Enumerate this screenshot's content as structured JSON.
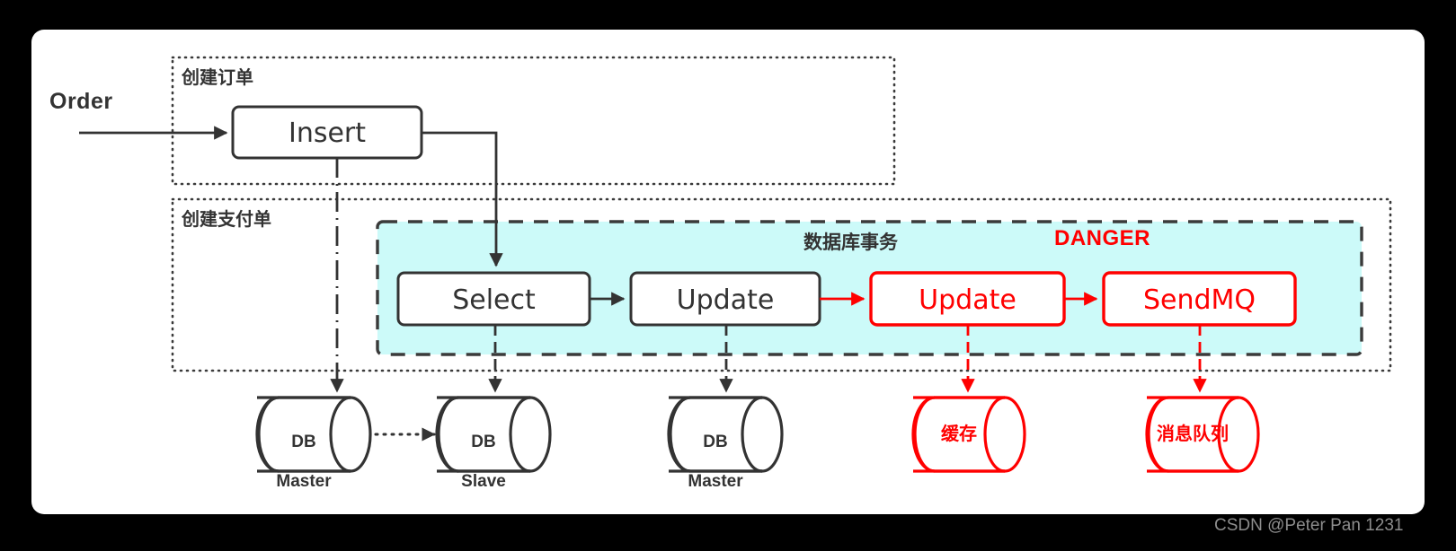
{
  "colors": {
    "canvas_background": "#000000",
    "card_background": "#ffffff",
    "ink": "#333333",
    "danger_red": "#FF0000",
    "transaction_fill": "#CCFAF9"
  },
  "entry": {
    "label": "Order"
  },
  "groups": [
    {
      "id": "create-order",
      "label": "创建订单"
    },
    {
      "id": "create-payment",
      "label": "创建支付单"
    }
  ],
  "transaction": {
    "label": "数据库事务",
    "danger_label": "DANGER"
  },
  "nodes": [
    {
      "id": "insert",
      "label": "Insert",
      "color": "ink"
    },
    {
      "id": "select",
      "label": "Select",
      "color": "ink"
    },
    {
      "id": "update-1",
      "label": "Update",
      "color": "ink"
    },
    {
      "id": "update-2",
      "label": "Update",
      "color": "red"
    },
    {
      "id": "sendmq",
      "label": "SendMQ",
      "color": "red"
    }
  ],
  "stores": [
    {
      "id": "db-master-1",
      "line1": "DB",
      "line2": "Master",
      "color": "ink"
    },
    {
      "id": "db-slave",
      "line1": "DB",
      "line2": "Slave",
      "color": "ink"
    },
    {
      "id": "db-master-2",
      "line1": "DB",
      "line2": "Master",
      "color": "ink"
    },
    {
      "id": "cache",
      "line1": "缓存",
      "line2": "",
      "color": "red"
    },
    {
      "id": "mq",
      "line1": "消息队列",
      "line2": "",
      "color": "red"
    }
  ],
  "watermark": {
    "text": "CSDN @Peter Pan 1231"
  }
}
